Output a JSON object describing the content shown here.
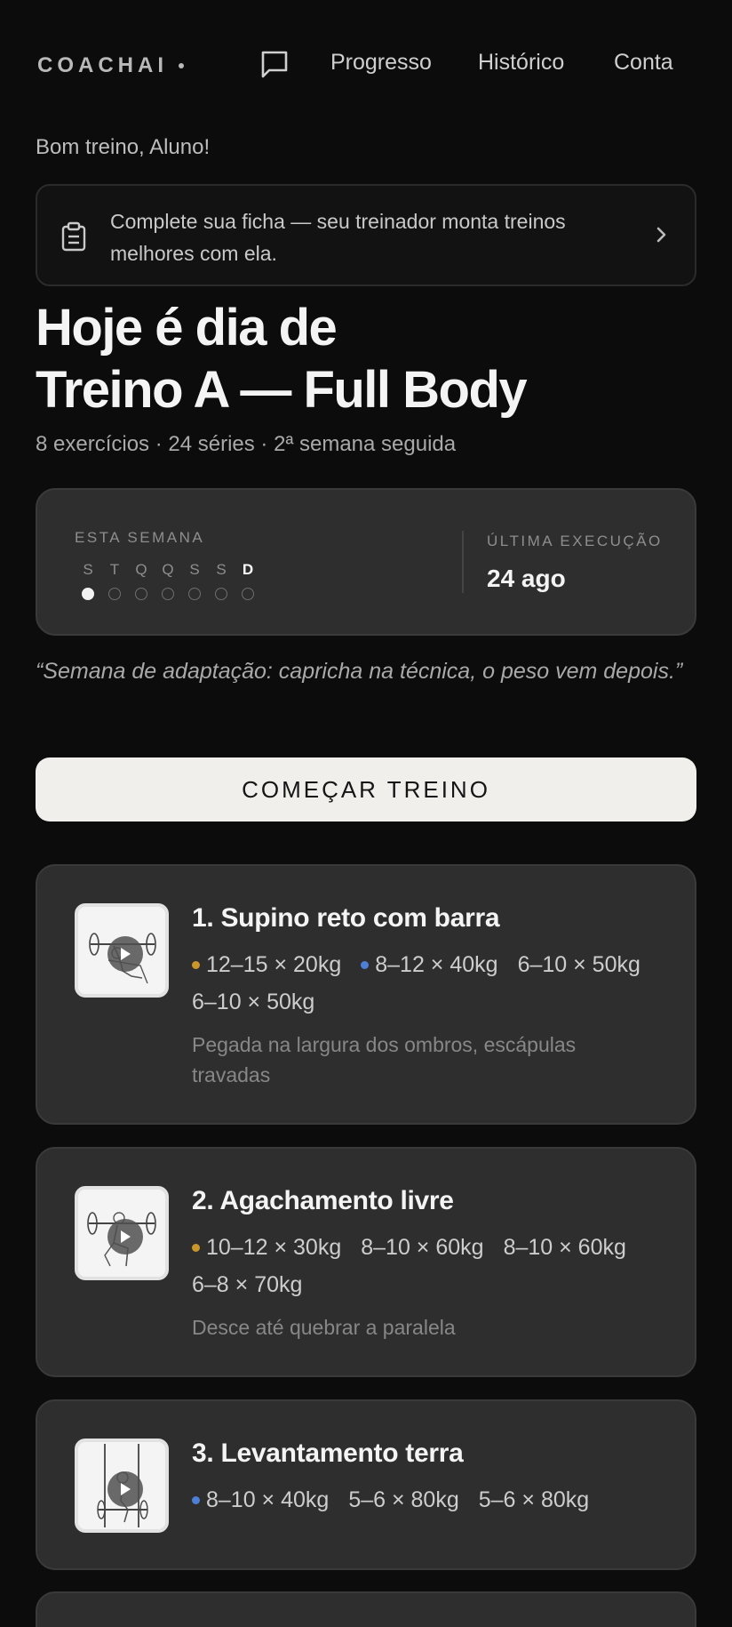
{
  "header": {
    "logo": "COACHAI",
    "nav": {
      "progresso": "Progresso",
      "historico": "Histórico",
      "conta": "Conta"
    }
  },
  "greeting": "Bom treino, Aluno!",
  "notice": {
    "text": "Complete sua ficha — seu treinador monta treinos melhores com ela."
  },
  "hero": {
    "line1": "Hoje é dia de",
    "line2": "Treino A — Full Body",
    "subtitle": "8 exercícios · 24 séries · 2ª semana seguida"
  },
  "week": {
    "label": "ESTA SEMANA",
    "days": [
      {
        "letter": "S",
        "done": true,
        "today": false
      },
      {
        "letter": "T",
        "done": false,
        "today": false
      },
      {
        "letter": "Q",
        "done": false,
        "today": false
      },
      {
        "letter": "Q",
        "done": false,
        "today": false
      },
      {
        "letter": "S",
        "done": false,
        "today": false
      },
      {
        "letter": "S",
        "done": false,
        "today": false
      },
      {
        "letter": "D",
        "done": false,
        "today": true
      }
    ],
    "last_label": "ÚLTIMA EXECUÇÃO",
    "last_value": "24 ago"
  },
  "quote": "“Semana de adaptação: capricha na técnica, o peso vem depois.”",
  "start_button": "COMEÇAR TREINO",
  "colors": {
    "gold_dot": "#c9962a",
    "blue_dot": "#4e7fd6"
  },
  "exercises": [
    {
      "title": "1. Supino reto com barra",
      "icon": "bench-press-figure",
      "sets": [
        {
          "text": "12–15 × 20kg",
          "marker": "gold"
        },
        {
          "text": "8–12 × 40kg",
          "marker": "blue"
        },
        {
          "text": "6–10 × 50kg",
          "marker": ""
        },
        {
          "text": "6–10 × 50kg",
          "marker": ""
        }
      ],
      "note": "Pegada na largura dos ombros, escápulas travadas"
    },
    {
      "title": "2. Agachamento livre",
      "icon": "squat-figure",
      "sets": [
        {
          "text": "10–12 × 30kg",
          "marker": "gold"
        },
        {
          "text": "8–10 × 60kg",
          "marker": ""
        },
        {
          "text": "8–10 × 60kg",
          "marker": ""
        },
        {
          "text": "6–8 × 70kg",
          "marker": ""
        }
      ],
      "note": "Desce até quebrar a paralela"
    },
    {
      "title": "3. Levantamento terra",
      "icon": "deadlift-figure",
      "sets": [
        {
          "text": "8–10 × 40kg",
          "marker": "blue"
        },
        {
          "text": "5–6 × 80kg",
          "marker": ""
        },
        {
          "text": "5–6 × 80kg",
          "marker": ""
        }
      ],
      "note": ""
    }
  ]
}
